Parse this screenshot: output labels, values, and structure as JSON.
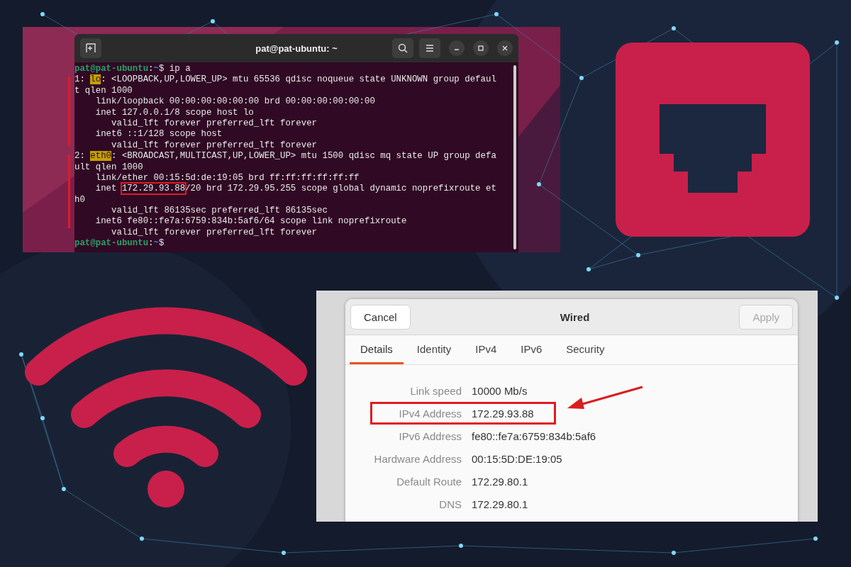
{
  "terminal": {
    "title": "pat@pat-ubuntu: ~",
    "lines": [
      {
        "segments": [
          {
            "kind": "user",
            "text": "pat@pat-ubuntu"
          },
          {
            "kind": "plain",
            "text": ":"
          },
          {
            "kind": "path",
            "text": "~"
          },
          {
            "kind": "plain",
            "text": "$ ip a"
          }
        ]
      },
      {
        "segments": [
          {
            "kind": "plain",
            "text": "1: "
          },
          {
            "kind": "highlight",
            "text": "lo"
          },
          {
            "kind": "plain",
            "text": ": <LOOPBACK,UP,LOWER_UP> mtu 65536 qdisc noqueue state UNKNOWN group defaul"
          }
        ]
      },
      {
        "segments": [
          {
            "kind": "plain",
            "text": "t qlen 1000"
          }
        ]
      },
      {
        "segments": [
          {
            "kind": "plain",
            "text": "    link/loopback 00:00:00:00:00:00 brd 00:00:00:00:00:00"
          }
        ]
      },
      {
        "segments": [
          {
            "kind": "plain",
            "text": "    inet 127.0.0.1/8 scope host lo"
          }
        ]
      },
      {
        "segments": [
          {
            "kind": "plain",
            "text": "       valid_lft forever preferred_lft forever"
          }
        ]
      },
      {
        "segments": [
          {
            "kind": "plain",
            "text": "    inet6 ::1/128 scope host"
          }
        ]
      },
      {
        "segments": [
          {
            "kind": "plain",
            "text": "       valid_lft forever preferred_lft forever"
          }
        ]
      },
      {
        "segments": [
          {
            "kind": "plain",
            "text": "2: "
          },
          {
            "kind": "highlight",
            "text": "eth0"
          },
          {
            "kind": "plain",
            "text": ": <BROADCAST,MULTICAST,UP,LOWER_UP> mtu 1500 qdisc mq state UP group defa"
          }
        ]
      },
      {
        "segments": [
          {
            "kind": "plain",
            "text": "ult qlen 1000"
          }
        ]
      },
      {
        "segments": [
          {
            "kind": "plain",
            "text": "    link/ether 00:15:5d:de:19:05 brd ff:ff:ff:ff:ff:ff"
          }
        ]
      },
      {
        "segments": [
          {
            "kind": "plain",
            "text": "    inet "
          },
          {
            "kind": "boxed",
            "text": "172.29.93.88"
          },
          {
            "kind": "plain",
            "text": "/20 brd 172.29.95.255 scope global dynamic noprefixroute et"
          }
        ]
      },
      {
        "segments": [
          {
            "kind": "plain",
            "text": "h0"
          }
        ]
      },
      {
        "segments": [
          {
            "kind": "plain",
            "text": "       valid_lft 86135sec preferred_lft 86135sec"
          }
        ]
      },
      {
        "segments": [
          {
            "kind": "plain",
            "text": "    inet6 fe80::fe7a:6759:834b:5af6/64 scope link noprefixroute"
          }
        ]
      },
      {
        "segments": [
          {
            "kind": "plain",
            "text": "       valid_lft forever preferred_lft forever"
          }
        ]
      },
      {
        "segments": [
          {
            "kind": "user",
            "text": "pat@pat-ubuntu"
          },
          {
            "kind": "plain",
            "text": ":"
          },
          {
            "kind": "path",
            "text": "~"
          },
          {
            "kind": "plain",
            "text": "$"
          }
        ]
      }
    ]
  },
  "dialog": {
    "title": "Wired",
    "cancel": {
      "label": "Cancel",
      "disabled": false
    },
    "apply": {
      "label": "Apply",
      "disabled": true
    },
    "tabs": [
      {
        "label": "Details",
        "selected": true
      },
      {
        "label": "Identity",
        "selected": false
      },
      {
        "label": "IPv4",
        "selected": false
      },
      {
        "label": "IPv6",
        "selected": false
      },
      {
        "label": "Security",
        "selected": false
      }
    ],
    "rows": [
      {
        "label": "Link speed",
        "value": "10000 Mb/s",
        "highlighted": false
      },
      {
        "label": "IPv4 Address",
        "value": "172.29.93.88",
        "highlighted": true
      },
      {
        "label": "IPv6 Address",
        "value": "fe80::fe7a:6759:834b:5af6",
        "highlighted": false
      },
      {
        "label": "Hardware Address",
        "value": "00:15:5D:DE:19:05",
        "highlighted": false
      },
      {
        "label": "Default Route",
        "value": "172.29.80.1",
        "highlighted": false
      },
      {
        "label": "DNS",
        "value": "172.29.80.1",
        "highlighted": false
      }
    ]
  }
}
